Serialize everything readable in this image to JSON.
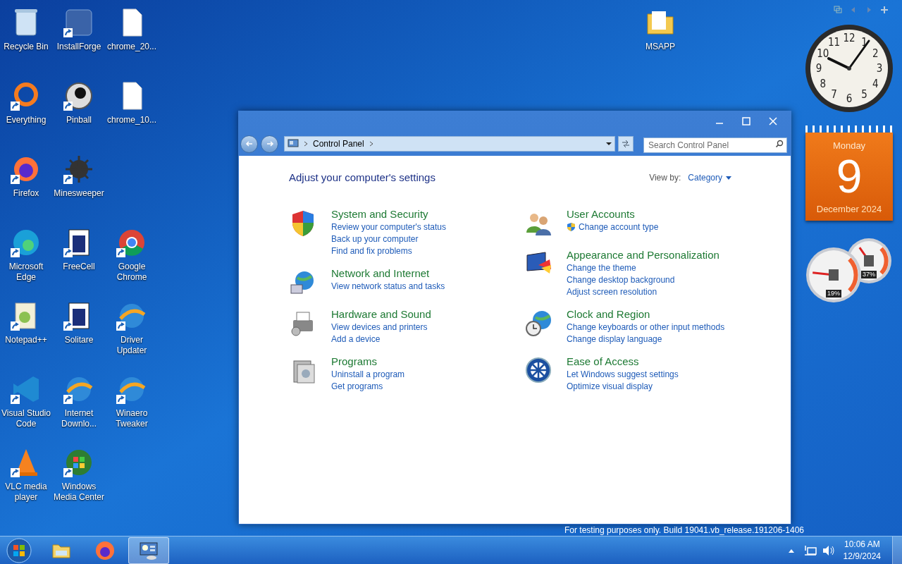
{
  "desktop": {
    "columns": [
      [
        {
          "label": "Recycle Bin",
          "kind": "bin",
          "shortcut": false
        },
        {
          "label": "Everything",
          "kind": "ring",
          "shortcut": true
        },
        {
          "label": "Firefox",
          "kind": "firefox",
          "shortcut": true
        },
        {
          "label": "Microsoft Edge",
          "kind": "edge",
          "shortcut": true
        },
        {
          "label": "Notepad++",
          "kind": "notepad",
          "shortcut": true
        },
        {
          "label": "Visual Studio Code",
          "kind": "vscode",
          "shortcut": true
        },
        {
          "label": "VLC media player",
          "kind": "vlc",
          "shortcut": true
        }
      ],
      [
        {
          "label": "InstallForge",
          "kind": "app",
          "shortcut": true
        },
        {
          "label": "Pinball",
          "kind": "ball",
          "shortcut": true
        },
        {
          "label": "Minesweeper",
          "kind": "mine",
          "shortcut": true
        },
        {
          "label": "FreeCell",
          "kind": "cards",
          "shortcut": true
        },
        {
          "label": "Solitare",
          "kind": "cards",
          "shortcut": true
        },
        {
          "label": "Internet Downlo...",
          "kind": "globe",
          "shortcut": true
        },
        {
          "label": "Windows Media Center",
          "kind": "orb",
          "shortcut": true
        }
      ],
      [
        {
          "label": "chrome_20...",
          "kind": "file",
          "shortcut": false
        },
        {
          "label": "chrome_10...",
          "kind": "file",
          "shortcut": false
        },
        null,
        {
          "label": "Google Chrome",
          "kind": "chrome",
          "shortcut": true
        },
        {
          "label": "Driver Updater",
          "kind": "globe",
          "shortcut": true
        },
        {
          "label": "Winaero Tweaker",
          "kind": "globe",
          "shortcut": true
        }
      ]
    ],
    "extra": {
      "label": "MSAPP",
      "kind": "folder",
      "shortcut": false
    },
    "build_text": "For testing purposes only. Build 19041.vb_release.191206-1406"
  },
  "window": {
    "breadcrumb": "Control Panel",
    "search": {
      "placeholder": "Search Control Panel"
    },
    "heading": "Adjust your computer's settings",
    "view_by_label": "View by:",
    "view_by_value": "Category",
    "columns": [
      [
        {
          "title": "System and Security",
          "kind": "shield",
          "links": [
            {
              "text": "Review your computer's status",
              "shield": false
            },
            {
              "text": "Back up your computer",
              "shield": false
            },
            {
              "text": "Find and fix problems",
              "shield": false
            }
          ]
        },
        {
          "title": "Network and Internet",
          "kind": "network",
          "links": [
            {
              "text": "View network status and tasks",
              "shield": false
            }
          ]
        },
        {
          "title": "Hardware and Sound",
          "kind": "printer",
          "links": [
            {
              "text": "View devices and printers",
              "shield": false
            },
            {
              "text": "Add a device",
              "shield": false
            }
          ]
        },
        {
          "title": "Programs",
          "kind": "programs",
          "links": [
            {
              "text": "Uninstall a program",
              "shield": false
            },
            {
              "text": "Get programs",
              "shield": false
            }
          ]
        }
      ],
      [
        {
          "title": "User Accounts",
          "kind": "users",
          "links": [
            {
              "text": "Change account type",
              "shield": true
            }
          ]
        },
        {
          "title": "Appearance and Personalization",
          "kind": "display",
          "links": [
            {
              "text": "Change the theme",
              "shield": false
            },
            {
              "text": "Change desktop background",
              "shield": false
            },
            {
              "text": "Adjust screen resolution",
              "shield": false
            }
          ]
        },
        {
          "title": "Clock and Region",
          "kind": "clock",
          "links": [
            {
              "text": "Change keyboards or other input methods",
              "shield": false
            },
            {
              "text": "Change display language",
              "shield": false
            }
          ]
        },
        {
          "title": "Ease of Access",
          "kind": "access",
          "links": [
            {
              "text": "Let Windows suggest settings",
              "shield": false
            },
            {
              "text": "Optimize visual display",
              "shield": false
            }
          ]
        }
      ]
    ]
  },
  "gadgets": {
    "clock_numerals": [
      "11",
      "12",
      "1",
      "10",
      "2",
      "9",
      "3",
      "8",
      "4",
      "7",
      "6",
      "5"
    ],
    "calendar": {
      "weekday": "Monday",
      "day": "9",
      "month_year": "December 2024"
    },
    "meters": [
      {
        "reading": "19%",
        "level": 0.19
      },
      {
        "reading": "37%",
        "level": 0.37
      }
    ]
  },
  "taskbar": {
    "apps": [
      {
        "kind": "explorer",
        "selected": false
      },
      {
        "kind": "firefox",
        "selected": false
      },
      {
        "kind": "control-panel",
        "selected": true
      }
    ],
    "time": "10:06 AM",
    "date": "12/9/2024"
  }
}
